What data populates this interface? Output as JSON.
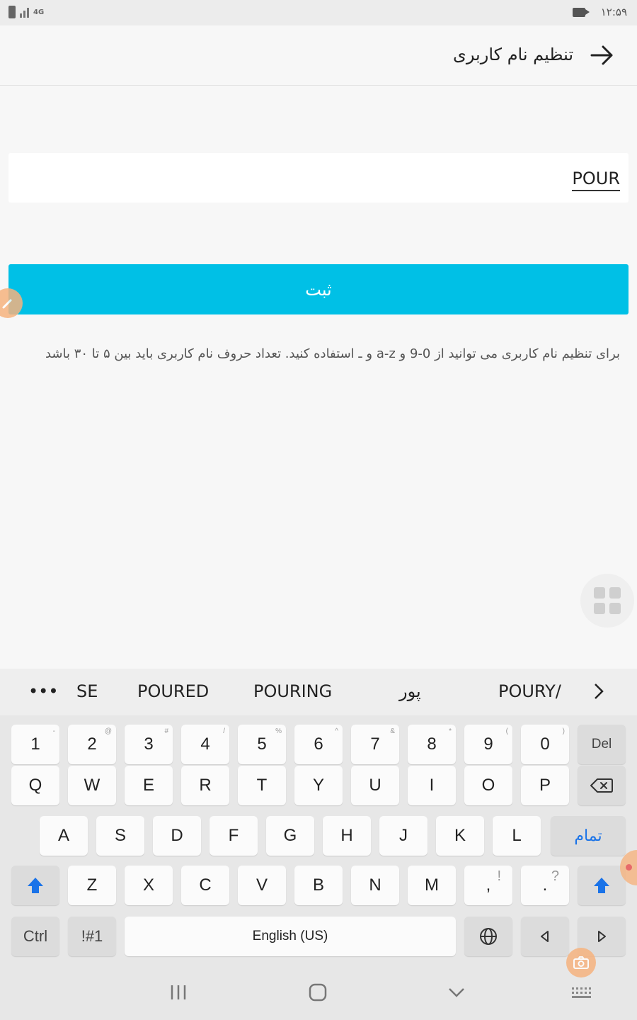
{
  "status_bar": {
    "network": "4G",
    "time": "۱۲:۵۹"
  },
  "header": {
    "title": "تنظیم نام کاربری"
  },
  "form": {
    "username_value": "POUR",
    "submit_label": "ثبت",
    "help_text": "برای تنظیم نام کاربری می توانید از 0-9 و a-z و ـ استفاده کنید. تعداد حروف نام کاربری باید بین ۵ تا ۳۰ باشد"
  },
  "suggestions": {
    "more_label": "•••",
    "items": [
      "SE",
      "POURED",
      "POURING",
      "پور",
      "POURY/"
    ],
    "next_label": "›"
  },
  "keyboard": {
    "number_row": [
      {
        "label": "1",
        "alt": "-"
      },
      {
        "label": "2",
        "alt": "@"
      },
      {
        "label": "3",
        "alt": "#"
      },
      {
        "label": "4",
        "alt": "/"
      },
      {
        "label": "5",
        "alt": "%"
      },
      {
        "label": "6",
        "alt": "^"
      },
      {
        "label": "7",
        "alt": "&"
      },
      {
        "label": "8",
        "alt": "*"
      },
      {
        "label": "9",
        "alt": "("
      },
      {
        "label": "0",
        "alt": ")"
      }
    ],
    "del_label": "Del",
    "row_q": [
      "Q",
      "W",
      "E",
      "R",
      "T",
      "Y",
      "U",
      "I",
      "O",
      "P"
    ],
    "row_a": [
      "A",
      "S",
      "D",
      "F",
      "G",
      "H",
      "J",
      "K",
      "L"
    ],
    "enter_label": "تمام",
    "row_z": [
      "Z",
      "X",
      "C",
      "V",
      "B",
      "N",
      "M"
    ],
    "comma_key": {
      "label": ",",
      "alt": "!"
    },
    "period_key": {
      "label": ".",
      "alt": "?"
    },
    "ctrl_label": "Ctrl",
    "symbols_label": "!#1",
    "space_label": "English (US)"
  },
  "colors": {
    "accent": "#00c0e6",
    "enter_text": "#1a73e8",
    "shift": "#1a73e8"
  }
}
